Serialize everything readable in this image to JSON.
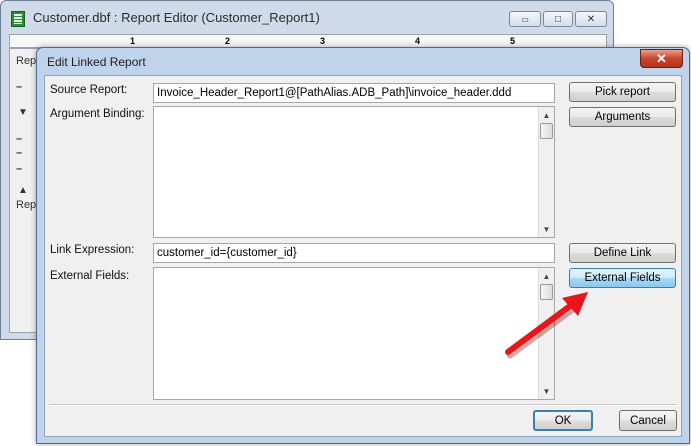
{
  "background_window": {
    "title": "Customer.dbf : Report Editor (Customer_Report1)",
    "app_icon": "table-icon",
    "ruler_marks": [
      "1",
      "2",
      "3",
      "4",
      "5"
    ],
    "left_labels": {
      "top": "Rep",
      "bottom": "Rep"
    },
    "caption_buttons": {
      "minimize": "▭",
      "maximize": "□",
      "close": "✕"
    }
  },
  "dialog": {
    "title": "Edit Linked Report",
    "close_glyph": "✕",
    "source_report": {
      "label": "Source Report:",
      "value": "Invoice_Header_Report1@[PathAlias.ADB_Path]\\invoice_header.ddd"
    },
    "argument_binding": {
      "label": "Argument Binding:",
      "value": ""
    },
    "link_expression": {
      "label": "Link Expression:",
      "value": "customer_id={customer_id}"
    },
    "external_fields": {
      "label": "External Fields:",
      "value": ""
    },
    "buttons": {
      "pick_report": "Pick report",
      "arguments": "Arguments",
      "define_link": "Define Link",
      "external_fields": "External Fields",
      "ok": "OK",
      "cancel": "Cancel"
    },
    "scroll_glyphs": {
      "up": "▲",
      "down": "▼"
    }
  },
  "annotation": {
    "arrow_color": "#e8151b"
  }
}
